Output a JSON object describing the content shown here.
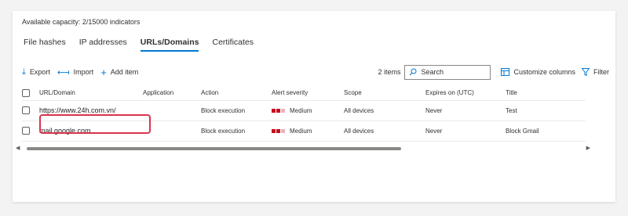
{
  "capacity_text": "Available capacity: 2/15000 indicators",
  "tabs": [
    {
      "label": "File hashes",
      "active": false
    },
    {
      "label": "IP addresses",
      "active": false
    },
    {
      "label": "URLs/Domains",
      "active": true
    },
    {
      "label": "Certificates",
      "active": false
    }
  ],
  "toolbar": {
    "export_label": "Export",
    "import_label": "Import",
    "add_item_label": "Add item",
    "items_count": "2 items",
    "search_placeholder": "Search",
    "customize_columns_label": "Customize columns",
    "filter_label": "Filter"
  },
  "table": {
    "headers": [
      "URL/Domain",
      "Application",
      "Action",
      "Alert severity",
      "Scope",
      "Expires on (UTC)",
      "Title"
    ],
    "rows": [
      {
        "url": "https://www.24h.com.vn/",
        "application": "",
        "action": "Block execution",
        "severity": "Medium",
        "scope": "All devices",
        "expires": "Never",
        "title": "Test"
      },
      {
        "url": "mail.google.com",
        "application": "",
        "action": "Block execution",
        "severity": "Medium",
        "scope": "All devices",
        "expires": "Never",
        "title": "Block Gmail"
      }
    ]
  },
  "colors": {
    "accent": "#0078d4",
    "severity_filled": "#c50f1f",
    "severity_empty": "#e8b4b8",
    "highlight_border": "#d9344b"
  },
  "icons": {
    "export": "download-arrow-icon",
    "import": "import-arrow-icon",
    "add": "plus-icon",
    "search": "search-icon",
    "customize": "columns-icon",
    "filter": "filter-icon"
  }
}
